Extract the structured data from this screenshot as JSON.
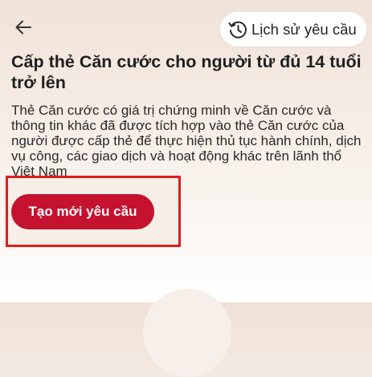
{
  "header": {
    "back_icon": "arrow-left-icon",
    "history_icon": "clock-history-icon",
    "history_label": "Lịch sử yêu cầu"
  },
  "main": {
    "title": "Cấp thẻ Căn cước cho người từ đủ 14 tuổi trở lên",
    "description": "Thẻ Căn cước có giá trị chứng minh về Căn cước và thông tin khác đã được tích hợp vào thẻ Căn cước của người được cấp thẻ để thực hiện thủ tục hành chính, dịch vụ công, các giao dịch và hoạt động khác trên lãnh thổ Việt Nam",
    "create_button_label": "Tạo mới yêu cầu"
  },
  "colors": {
    "accent": "#c4122f",
    "highlight_border": "#e31b1b"
  }
}
